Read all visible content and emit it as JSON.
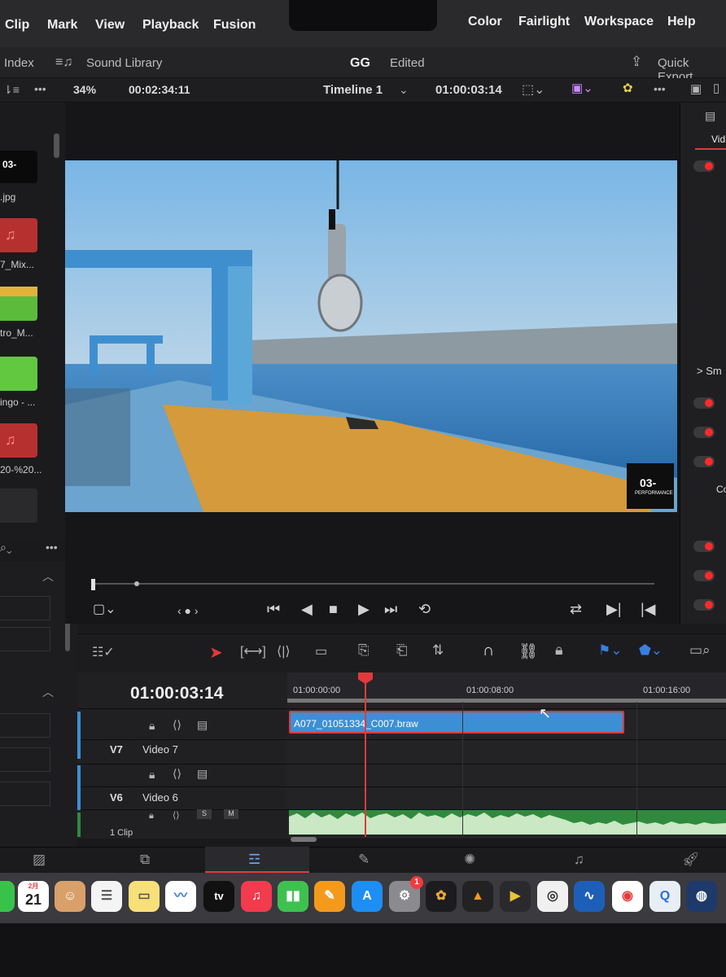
{
  "menubar": {
    "items": [
      "Clip",
      "Mark",
      "View",
      "Playback",
      "Fusion",
      "Color",
      "Fairlight",
      "Workspace",
      "Help"
    ]
  },
  "toolbar2": {
    "index_label": "Index",
    "sound_library_label": "Sound Library",
    "project_name": "GG",
    "project_status": "Edited",
    "quick_export_label": "Quick Export"
  },
  "viewer_bar": {
    "zoom": "34%",
    "source_timecode": "00:02:34:11",
    "timeline_name": "Timeline 1",
    "record_timecode": "01:00:03:14"
  },
  "media_pool": {
    "items": [
      {
        "label": ".jpg",
        "thumb_text": "03-"
      },
      {
        "label": "7_Mix..."
      },
      {
        "label": "tro_M..."
      },
      {
        "label": "ingo - ..."
      },
      {
        "label": "20-%20..."
      }
    ]
  },
  "viewer": {
    "watermark": "03-",
    "watermark_sub": "PERFORMANCE"
  },
  "inspector": {
    "tab_label": "Vid",
    "section_label": "> Sm",
    "row_co": "Co"
  },
  "timeline": {
    "current_timecode": "01:00:03:14",
    "ruler": [
      "01:00:00:00",
      "01:00:08:00",
      "01:00:16:00"
    ],
    "tracks": [
      {
        "id": "V7",
        "name": "Video 7"
      },
      {
        "id": "V6",
        "name": "Video 6"
      }
    ],
    "audio_clip_count": "1 Clip",
    "audio_s": "S",
    "audio_m": "M",
    "clip_name": "A077_01051334_C007.braw"
  },
  "dock": {
    "calendar_month": "2月",
    "calendar_day": "21",
    "tv_label": "tv",
    "badge": "1"
  },
  "colors": {
    "clip_blue": "#3d8fd4",
    "playhead_red": "#e23a3a",
    "audio_green": "#2f8a3e",
    "accent_red": "#ff2a2a"
  }
}
